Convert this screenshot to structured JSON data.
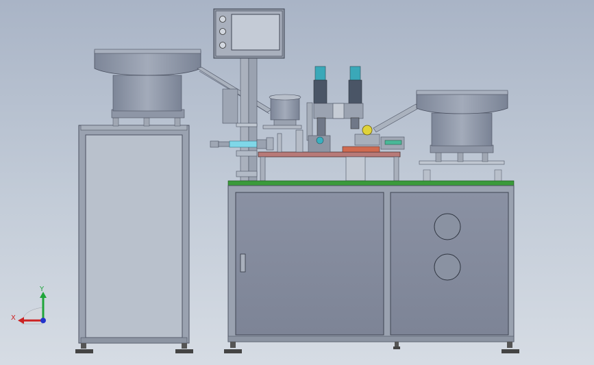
{
  "triad": {
    "x_label": "X",
    "y_label": "Y"
  },
  "colors": {
    "background_top": "#a9b4c6",
    "frame": "#8f98a6",
    "panel": "#878ea0",
    "work_plate": "#b87a78",
    "table_top": "#3a9a3a",
    "x_axis": "#cc2222",
    "y_axis": "#1fa53a",
    "z_axis": "#2233cc"
  },
  "icons": [
    "coordinate-triad-icon",
    "hmi-screen-icon",
    "door-handle-icon"
  ]
}
